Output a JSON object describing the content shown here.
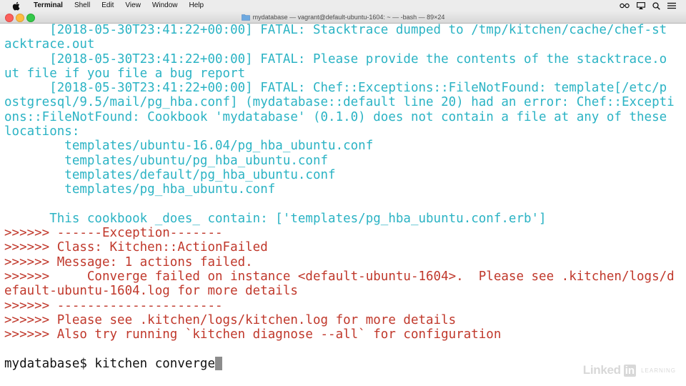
{
  "menubar": {
    "app_name": "Terminal",
    "items": [
      "Shell",
      "Edit",
      "View",
      "Window",
      "Help"
    ]
  },
  "window": {
    "title": "mydatabase — vagrant@default-ubuntu-1604: ~ — -bash — 89×24"
  },
  "terminal": {
    "lines": [
      {
        "text": "      [2018-05-30T23:41:22+00:00] FATAL: Stacktrace dumped to /tmp/kitchen/cache/chef-st",
        "color": "cyan"
      },
      {
        "text": "acktrace.out",
        "color": "cyan"
      },
      {
        "text": "      [2018-05-30T23:41:22+00:00] FATAL: Please provide the contents of the stacktrace.o",
        "color": "cyan"
      },
      {
        "text": "ut file if you file a bug report",
        "color": "cyan"
      },
      {
        "text": "      [2018-05-30T23:41:22+00:00] FATAL: Chef::Exceptions::FileNotFound: template[/etc/p",
        "color": "cyan"
      },
      {
        "text": "ostgresql/9.5/mail/pg_hba.conf] (mydatabase::default line 20) had an error: Chef::Excepti",
        "color": "cyan"
      },
      {
        "text": "ons::FileNotFound: Cookbook 'mydatabase' (0.1.0) does not contain a file at any of these",
        "color": "cyan"
      },
      {
        "text": "locations:",
        "color": "cyan"
      },
      {
        "text": "        templates/ubuntu-16.04/pg_hba_ubuntu.conf",
        "color": "cyan"
      },
      {
        "text": "        templates/ubuntu/pg_hba_ubuntu.conf",
        "color": "cyan"
      },
      {
        "text": "        templates/default/pg_hba_ubuntu.conf",
        "color": "cyan"
      },
      {
        "text": "        templates/pg_hba_ubuntu.conf",
        "color": "cyan"
      },
      {
        "text": "",
        "color": "cyan"
      },
      {
        "text": "      This cookbook _does_ contain: ['templates/pg_hba_ubuntu.conf.erb']",
        "color": "cyan"
      },
      {
        "text": ">>>>>> ------Exception-------",
        "color": "red"
      },
      {
        "text": ">>>>>> Class: Kitchen::ActionFailed",
        "color": "red"
      },
      {
        "text": ">>>>>> Message: 1 actions failed.",
        "color": "red"
      },
      {
        "text": ">>>>>>     Converge failed on instance <default-ubuntu-1604>.  Please see .kitchen/logs/d",
        "color": "red"
      },
      {
        "text": "efault-ubuntu-1604.log for more details",
        "color": "red"
      },
      {
        "text": ">>>>>> ----------------------",
        "color": "red"
      },
      {
        "text": ">>>>>> Please see .kitchen/logs/kitchen.log for more details",
        "color": "red"
      },
      {
        "text": ">>>>>> Also try running `kitchen diagnose --all` for configuration",
        "color": "red"
      },
      {
        "text": "",
        "color": "red"
      }
    ],
    "prompt": "mydatabase$ kitchen converge"
  },
  "watermark": {
    "brand_word": "Linked",
    "brand_box": "in",
    "sub": "LEARNING"
  },
  "colors": {
    "cyan": "#2bb3c4",
    "red": "#c0382b"
  }
}
